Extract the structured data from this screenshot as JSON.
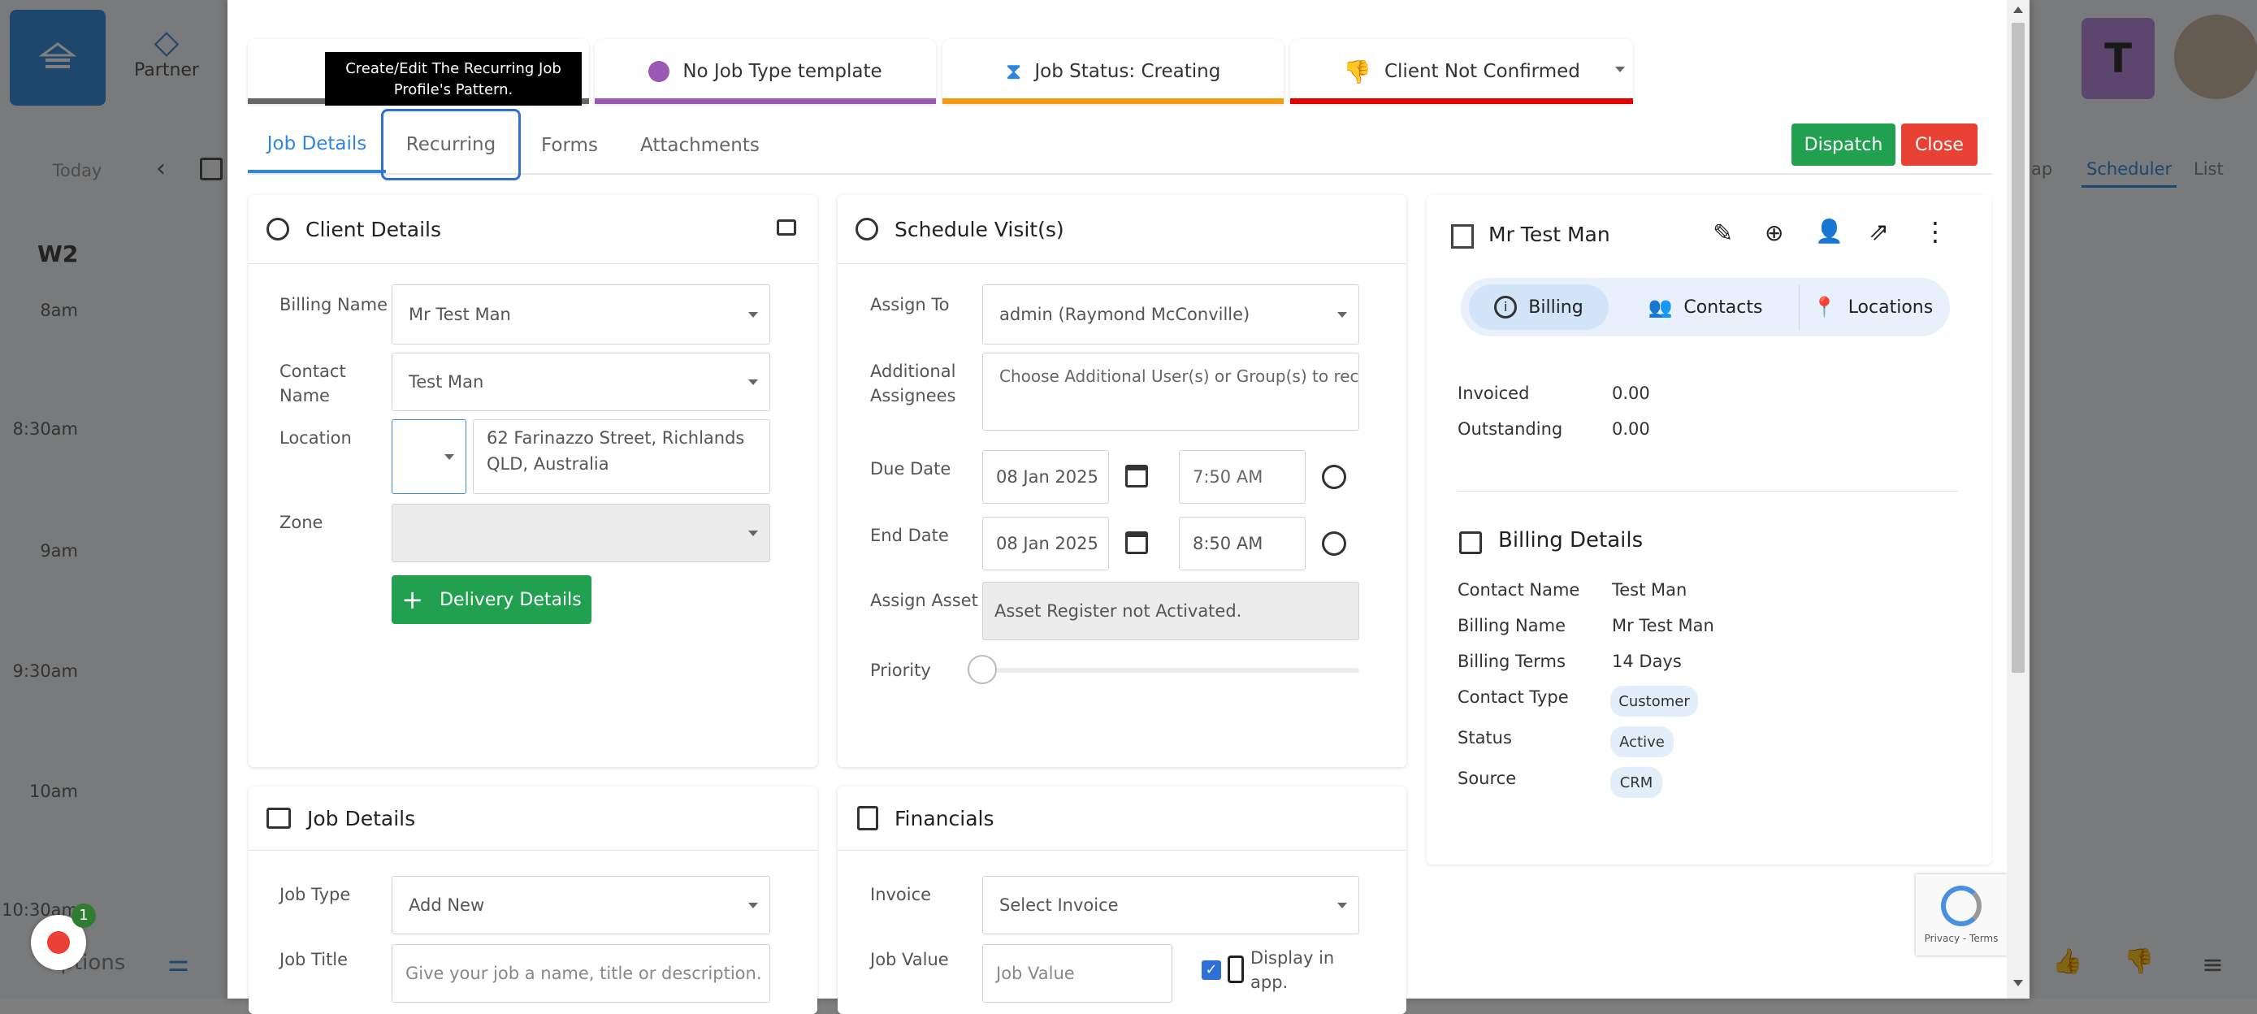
{
  "background": {
    "partner_label": "Partner",
    "today_label": "Today",
    "week_label": "W2",
    "times": [
      "8am",
      "8:30am",
      "9am",
      "9:30am",
      "10am",
      "10:30am"
    ],
    "view_tabs": [
      "ap",
      "Scheduler",
      "List"
    ],
    "options_label": "Options",
    "notification_count": "1"
  },
  "tooltip": {
    "text": "Create/Edit The Recurring Job Profile's Pattern."
  },
  "status_cards": {
    "job_type": "No Job Type template",
    "job_status": "Job Status: Creating",
    "client_confirm": "Client Not Confirmed"
  },
  "tabs": [
    "Job Details",
    "Recurring",
    "Forms",
    "Attachments"
  ],
  "actions": {
    "dispatch": "Dispatch",
    "close": "Close"
  },
  "client_details": {
    "title": "Client Details",
    "billing_name_label": "Billing Name",
    "billing_name_value": "Mr Test Man",
    "contact_name_label": "Contact Name",
    "contact_name_value": "Test Man",
    "location_label": "Location",
    "location_value": "62 Farinazzo Street, Richlands QLD, Australia",
    "zone_label": "Zone",
    "delivery_button": "Delivery Details"
  },
  "schedule": {
    "title": "Schedule Visit(s)",
    "assign_to_label": "Assign To",
    "assign_to_value": "admin (Raymond McConville)",
    "additional_label": "Additional Assignees",
    "additional_placeholder": "Choose Additional User(s) or Group(s) to receive",
    "due_label": "Due Date",
    "due_date": "08 Jan 2025",
    "due_time": "7:50 AM",
    "end_label": "End Date",
    "end_date": "08 Jan 2025",
    "end_time": "8:50 AM",
    "asset_label": "Assign Asset",
    "asset_value": "Asset Register not Activated.",
    "priority_label": "Priority",
    "priority_value": 0
  },
  "client_panel": {
    "name": "Mr Test Man",
    "tabs": [
      "Billing",
      "Contacts",
      "Locations"
    ],
    "invoiced_label": "Invoiced",
    "invoiced_value": "0.00",
    "outstanding_label": "Outstanding",
    "outstanding_value": "0.00",
    "billing_details_title": "Billing Details",
    "rows": [
      {
        "label": "Contact Name",
        "value": "Test Man"
      },
      {
        "label": "Billing Name",
        "value": "Mr Test Man"
      },
      {
        "label": "Billing Terms",
        "value": "14 Days"
      },
      {
        "label": "Contact Type",
        "value": "Customer"
      },
      {
        "label": "Status",
        "value": "Active"
      },
      {
        "label": "Source",
        "value": "CRM"
      }
    ]
  },
  "job_details": {
    "title": "Job Details",
    "job_type_label": "Job Type",
    "job_type_value": "Add New",
    "job_title_label": "Job Title",
    "job_title_placeholder": "Give your job a name, title or description."
  },
  "financials": {
    "title": "Financials",
    "invoice_label": "Invoice",
    "invoice_value": "Select Invoice",
    "job_value_label": "Job Value",
    "job_value_placeholder": "Job Value",
    "display_in_app": "Display in app."
  },
  "recaptcha": {
    "terms": "Privacy - Terms"
  },
  "colors": {
    "primary": "#2e86de",
    "dispatch": "#21a150",
    "close": "#e94235",
    "job_type_bar": "#9b59b6",
    "status_bar": "#f39c12",
    "confirm_bar": "#e00000"
  }
}
